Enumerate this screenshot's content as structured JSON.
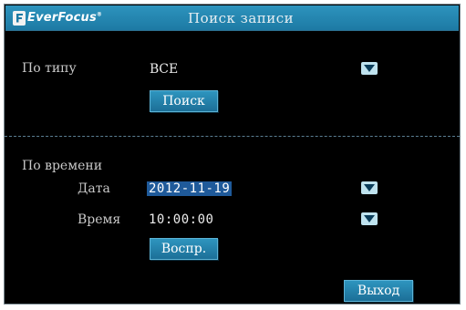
{
  "header": {
    "brand": "EverFocus",
    "brand_mark": "®",
    "title": "Поиск записи"
  },
  "by_type": {
    "label": "По типу",
    "selected": "ВСЕ",
    "search_button": "Поиск"
  },
  "by_time": {
    "label": "По времени",
    "date_label": "Дата",
    "date_value": "2012-11-19",
    "time_label": "Время",
    "time_value": "10:00:00",
    "play_button": "Воспр."
  },
  "footer": {
    "exit_button": "Выход"
  },
  "colors": {
    "title_bar": "#1d7aa4",
    "background": "#000000",
    "button": "#1c6f97",
    "selection": "#1f5a9a"
  }
}
